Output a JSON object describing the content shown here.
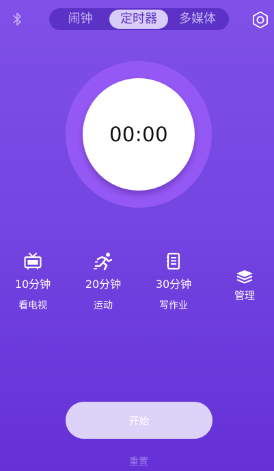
{
  "header": {
    "tabs": [
      {
        "label": "闹钟"
      },
      {
        "label": "定时器"
      },
      {
        "label": "多媒体"
      }
    ],
    "selected_tab": "定时器",
    "bluetooth_icon": "bluetooth-icon",
    "settings_icon": "settings-icon"
  },
  "timer": {
    "time": "00:00"
  },
  "presets": [
    {
      "icon": "tv-icon",
      "duration": "10分钟",
      "label": "看电视"
    },
    {
      "icon": "running-icon",
      "duration": "20分钟",
      "label": "运动"
    },
    {
      "icon": "notebook-icon",
      "duration": "30分钟",
      "label": "写作业"
    }
  ],
  "manage": {
    "icon": "layers-icon",
    "label": "管理"
  },
  "actions": {
    "start_label": "开始",
    "reset_label": "重置"
  },
  "colors": {
    "background_top": "#8050e8",
    "background_bottom": "#6530d6",
    "ring": "#9458f4",
    "tab_bar": "#5b31c6",
    "tab_selected": "#d8ccf9",
    "start_button": "#ddd2f8"
  }
}
